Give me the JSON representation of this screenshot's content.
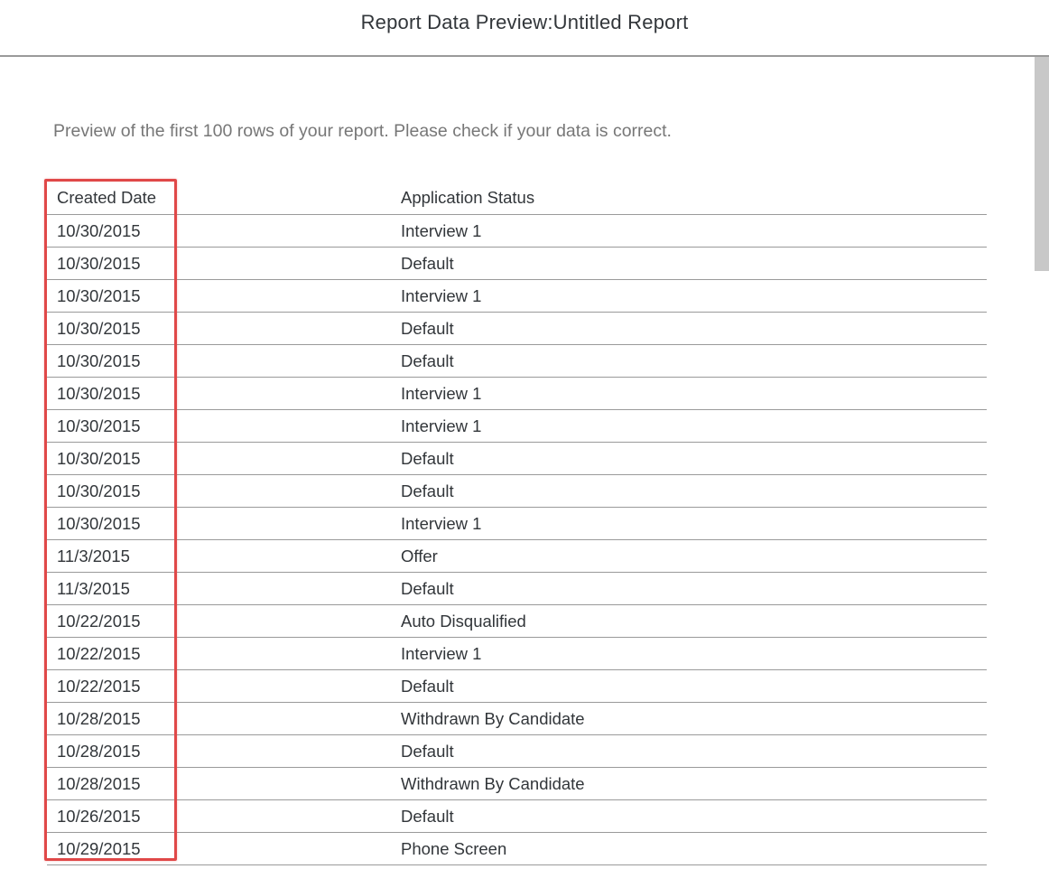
{
  "header": {
    "title": "Report Data Preview:Untitled Report"
  },
  "content": {
    "description": "Preview of the first 100 rows of your report. Please check if your data is correct."
  },
  "table": {
    "columns": [
      "Created Date",
      "Application Status"
    ],
    "rows": [
      [
        "10/30/2015",
        "Interview 1"
      ],
      [
        "10/30/2015",
        "Default"
      ],
      [
        "10/30/2015",
        "Interview 1"
      ],
      [
        "10/30/2015",
        "Default"
      ],
      [
        "10/30/2015",
        "Default"
      ],
      [
        "10/30/2015",
        "Interview 1"
      ],
      [
        "10/30/2015",
        "Interview 1"
      ],
      [
        "10/30/2015",
        "Default"
      ],
      [
        "10/30/2015",
        "Default"
      ],
      [
        "10/30/2015",
        "Interview 1"
      ],
      [
        "11/3/2015",
        "Offer"
      ],
      [
        "11/3/2015",
        "Default"
      ],
      [
        "10/22/2015",
        "Auto Disqualified"
      ],
      [
        "10/22/2015",
        "Interview 1"
      ],
      [
        "10/22/2015",
        "Default"
      ],
      [
        "10/28/2015",
        "Withdrawn By Candidate"
      ],
      [
        "10/28/2015",
        "Default"
      ],
      [
        "10/28/2015",
        "Withdrawn By Candidate"
      ],
      [
        "10/26/2015",
        "Default"
      ],
      [
        "10/29/2015",
        "Phone Screen"
      ]
    ]
  },
  "colors": {
    "highlight": "#e04848",
    "divider": "#9a9a9a",
    "scrollbar_thumb": "#c8c8c8"
  }
}
